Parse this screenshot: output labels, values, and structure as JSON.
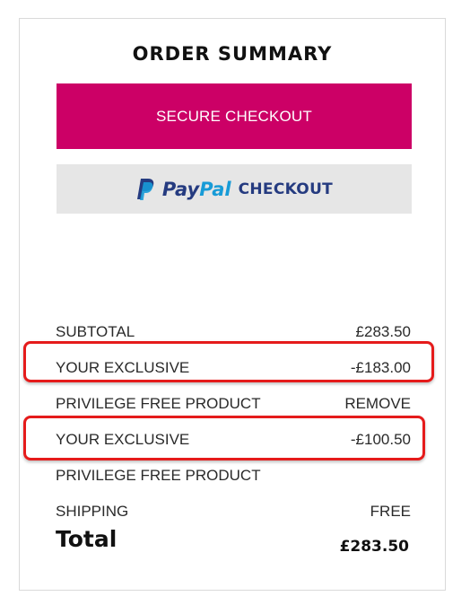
{
  "summary": {
    "title": "ORDER SUMMARY",
    "secure_checkout_label": "SECURE CHECKOUT",
    "paypal": {
      "pay": "Pay",
      "pal": "Pal",
      "checkout": "CHECKOUT",
      "icon": "paypal-logo-icon",
      "colors": {
        "dark": "#253b80",
        "light": "#179bd7"
      }
    },
    "colors": {
      "checkout_button": "#cc0066",
      "highlight": "#e51b1b"
    }
  },
  "lines": {
    "subtotal": {
      "label": "SUBTOTAL",
      "value": "£283.50"
    },
    "exclusive_1": {
      "label": "YOUR EXCLUSIVE",
      "value": "-£183.00"
    },
    "privilege_1": {
      "label": "PRIVILEGE FREE PRODUCT",
      "action": "REMOVE"
    },
    "exclusive_2": {
      "label": "YOUR EXCLUSIVE",
      "value": "-£100.50"
    },
    "privilege_2": {
      "label": "PRIVILEGE FREE PRODUCT"
    },
    "shipping": {
      "label": "SHIPPING",
      "value": "FREE"
    }
  },
  "total": {
    "label": "Total",
    "value": "£283.50"
  }
}
